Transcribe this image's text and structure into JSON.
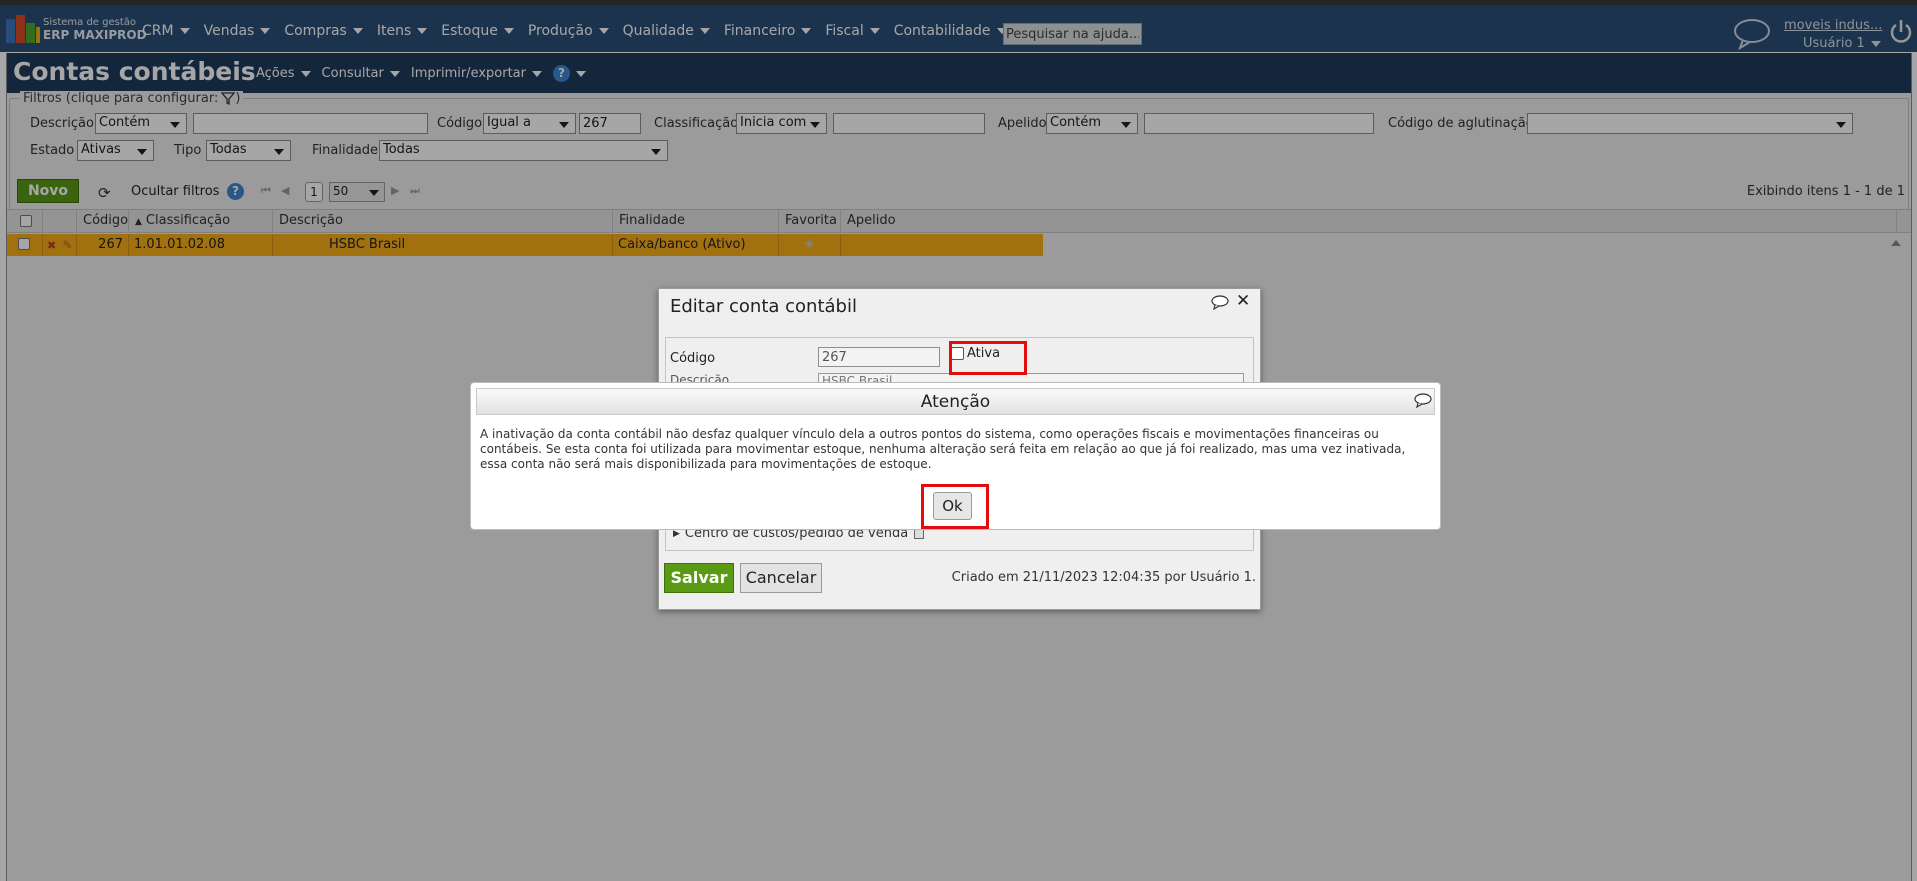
{
  "header": {
    "logo_line1": "Sistema de gestão",
    "logo_line2": "ERP MAXIPROD",
    "menu": [
      "CRM",
      "Vendas",
      "Compras",
      "Itens",
      "Estoque",
      "Produção",
      "Qualidade",
      "Financeiro",
      "Fiscal",
      "Contabilidade"
    ],
    "search_value": "Pesquisar na ajuda...",
    "company": "moveis indus...",
    "user": "Usuário 1"
  },
  "page": {
    "title": "Contas contábeis",
    "menu": [
      "Ações",
      "Consultar",
      "Imprimir/exportar"
    ]
  },
  "filters": {
    "legend": "Filtros (clique para configurar:",
    "legend_end": ")",
    "descricao_label": "Descrição",
    "descricao_op": "Contém",
    "descricao_value": "",
    "codigo_label": "Código",
    "codigo_op": "Igual a",
    "codigo_value": "267",
    "classificacao_label": "Classificação",
    "classificacao_op": "Inicia com",
    "classificacao_value": "",
    "apelido_label": "Apelido",
    "apelido_op": "Contém",
    "apelido_value": "",
    "aglutinacao_label": "Código de aglutinação",
    "aglutinacao_value": "",
    "estado_label": "Estado",
    "estado_value": "Ativas",
    "tipo_label": "Tipo",
    "tipo_value": "Todas",
    "finalidade_label": "Finalidade",
    "finalidade_value": "Todas"
  },
  "toolbar": {
    "novo": "Novo",
    "toggle_filters": "Ocultar filtros",
    "page": "1",
    "page_size": "50",
    "info": "Exibindo itens 1 - 1 de 1"
  },
  "grid": {
    "headers": [
      "Código",
      "Classificação",
      "Descrição",
      "Finalidade",
      "Favorita",
      "Apelido"
    ],
    "rows": [
      {
        "codigo": "267",
        "classificacao": "1.01.01.02.08",
        "descricao": "HSBC Brasil",
        "finalidade": "Caixa/banco (Ativo)",
        "favorita": "★",
        "apelido": ""
      }
    ]
  },
  "edit_dialog": {
    "title": "Editar conta contábil",
    "codigo_label": "Código",
    "codigo_value": "267",
    "ativa_label": "Ativa",
    "row2_label": "Descrição",
    "row2_value": "HSBC Brasil",
    "centro_label": "Centro de custos/pedido de venda",
    "salvar": "Salvar",
    "cancelar": "Cancelar",
    "created": "Criado em 21/11/2023 12:04:35 por Usuário 1."
  },
  "alert": {
    "title": "Atenção",
    "message": "A inativação da conta contábil não desfaz qualquer vínculo dela a outros pontos do sistema, como operações fiscais e movimentações financeiras ou contábeis. Se esta conta foi utilizada para movimentar estoque, nenhuma alteração será feita em relação ao que já foi realizado, mas uma vez inativada, essa conta não será mais disponibilizada para movimentações de estoque.",
    "ok": "Ok"
  },
  "colors": {
    "topbar": "#2c4f77",
    "titlebar": "#1f3b5c",
    "selected_row": "#f7ae1a",
    "primary_button": "#5a9a14",
    "highlight": "#e30d0d"
  }
}
